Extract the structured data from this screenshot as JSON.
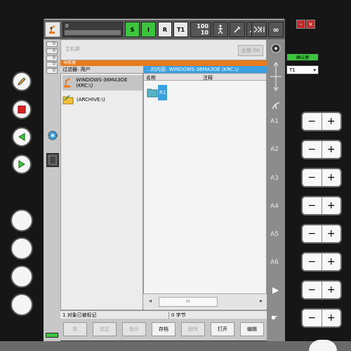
{
  "status": {
    "program_number": "0",
    "btn_s": "S",
    "btn_i": "I",
    "btn_r": "R",
    "btn_t1": "T1",
    "override_top": "100",
    "override_bottom": "10",
    "infinity": "∞"
  },
  "mini_counts": [
    "0",
    "0",
    "0",
    "0",
    "0"
  ],
  "messages": {
    "placeholder": "主机屏",
    "ok_all": "全部 OK"
  },
  "navigator": {
    "title": "导航器",
    "filter": "过滤器: 用户",
    "path": "…的内容: WINDOWS-36MA3OE (KRC:\\)",
    "tree": [
      {
        "label": "WINDOWS-36MA3OE (KRC:\\)"
      },
      {
        "label": "(ARCHIVE:\\)"
      }
    ],
    "columns": {
      "name": "名称",
      "comment": "注释"
    },
    "files": [
      {
        "label": "R1"
      }
    ],
    "scroll_label": "01"
  },
  "statusline": {
    "selected": "1 对象已被标记",
    "bytes": "0 字节"
  },
  "softkeys": [
    {
      "label": "新",
      "enabled": false
    },
    {
      "label": "选定",
      "enabled": false
    },
    {
      "label": "备份",
      "enabled": false
    },
    {
      "label": "存档",
      "enabled": true
    },
    {
      "label": "删除",
      "enabled": false
    },
    {
      "label": "打开",
      "enabled": true
    },
    {
      "label": "编辑",
      "enabled": true
    }
  ],
  "right_panel": {
    "confirm": "确认键",
    "mode": "T1"
  },
  "axes": [
    "A1",
    "A2",
    "A3",
    "A4",
    "A5",
    "A6"
  ],
  "jog": {
    "minus": "−",
    "plus": "+"
  },
  "window": {
    "minimize": "–",
    "close": "×"
  }
}
